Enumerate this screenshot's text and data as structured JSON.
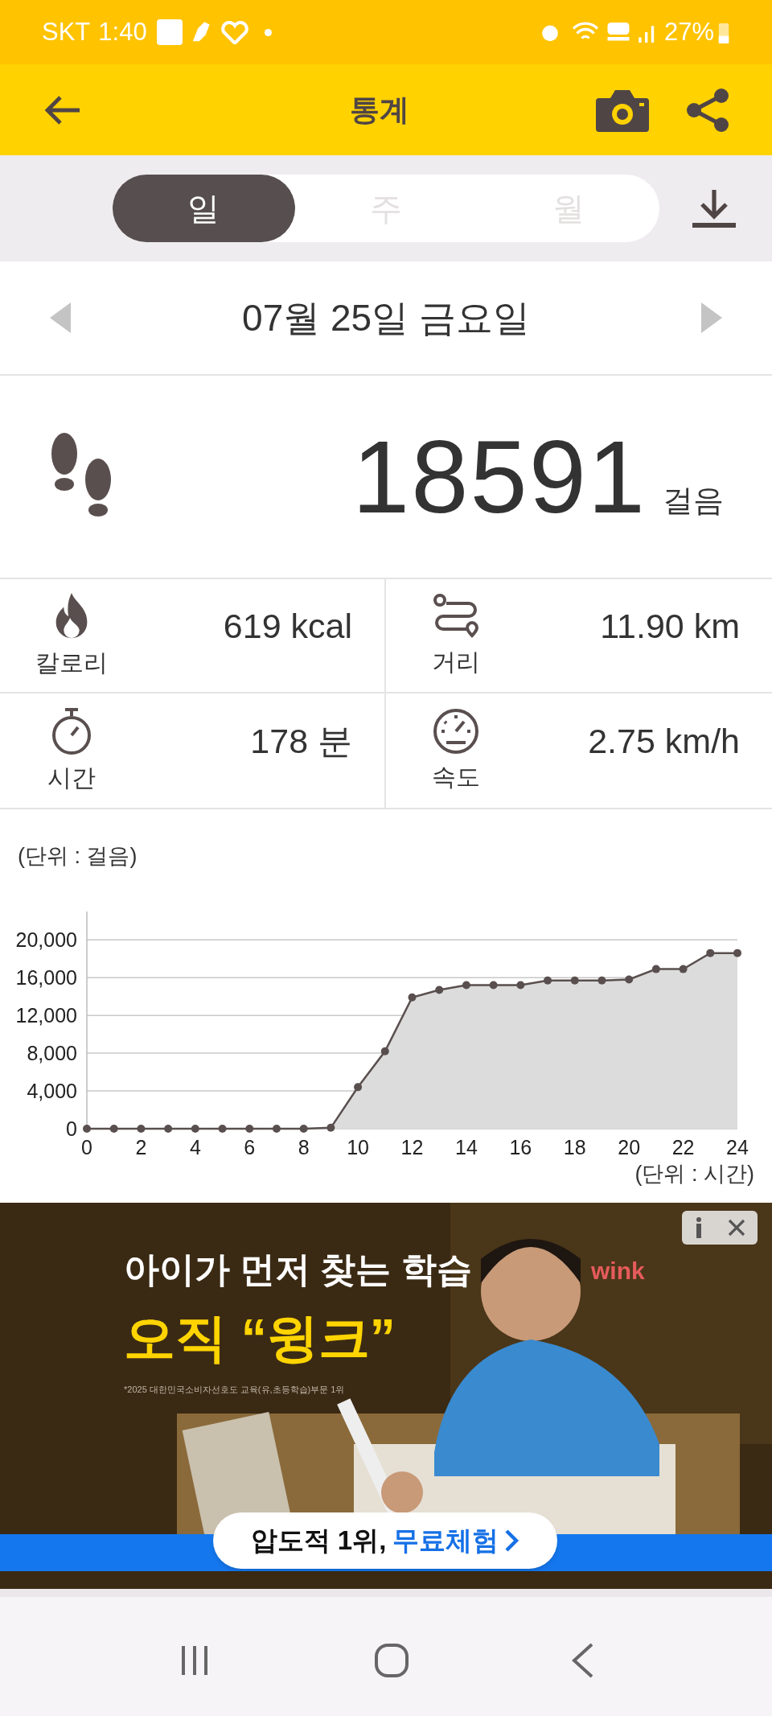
{
  "status_bar": {
    "carrier": "SKT",
    "time": "1:40",
    "battery": "27%"
  },
  "header": {
    "title": "통계"
  },
  "tabs": [
    {
      "label": "일",
      "selected": true
    },
    {
      "label": "주",
      "selected": false
    },
    {
      "label": "월",
      "selected": false
    }
  ],
  "date": "07월 25일 금요일",
  "steps": {
    "value": "18591",
    "unit": "걸음"
  },
  "stats": [
    {
      "kind": "calories",
      "label": "칼로리",
      "value": "619 kcal"
    },
    {
      "kind": "distance",
      "label": "거리",
      "value": "11.90 km"
    },
    {
      "kind": "time",
      "label": "시간",
      "value": "178 분"
    },
    {
      "kind": "speed",
      "label": "속도",
      "value": "2.75 km/h"
    }
  ],
  "chart": {
    "unit_label": "(단위 : 걸음)",
    "x_unit_label": "(단위 : 시간)",
    "chart_data": {
      "type": "area",
      "x": [
        0,
        1,
        2,
        3,
        4,
        5,
        6,
        7,
        8,
        9,
        10,
        11,
        12,
        13,
        14,
        15,
        16,
        17,
        18,
        19,
        20,
        21,
        22,
        23,
        24
      ],
      "grid": true,
      "series": [
        {
          "color": "#5a4f4f",
          "values": [
            0,
            0,
            0,
            0,
            0,
            0,
            0,
            0,
            0,
            100,
            4400,
            8200,
            13900,
            14700,
            15200,
            15200,
            15200,
            15700,
            15700,
            15700,
            15800,
            16900,
            16900,
            18600,
            18600
          ]
        }
      ],
      "xlim": [
        0,
        24
      ],
      "ylim": [
        0,
        23000
      ],
      "xticks": [
        0,
        2,
        4,
        6,
        8,
        10,
        12,
        14,
        16,
        18,
        20,
        22,
        24
      ],
      "yticks": [
        {
          "value": 0,
          "label": "0"
        },
        {
          "value": 4000,
          "label": "4,000"
        },
        {
          "value": 8000,
          "label": "8,000"
        },
        {
          "value": 12000,
          "label": "12,000"
        },
        {
          "value": 16000,
          "label": "16,000"
        },
        {
          "value": 20000,
          "label": "20,000"
        }
      ]
    }
  },
  "ad": {
    "headline": "아이가 먼저 찾는 학습",
    "title": "오직 “윙크”",
    "disclaimer": "*2025 대한민국소비자선호도 교육(유,초등학습)부문 1위",
    "brand": "wink",
    "cta_lead": "압도적 1위,",
    "cta_highlight": "무료체험"
  }
}
